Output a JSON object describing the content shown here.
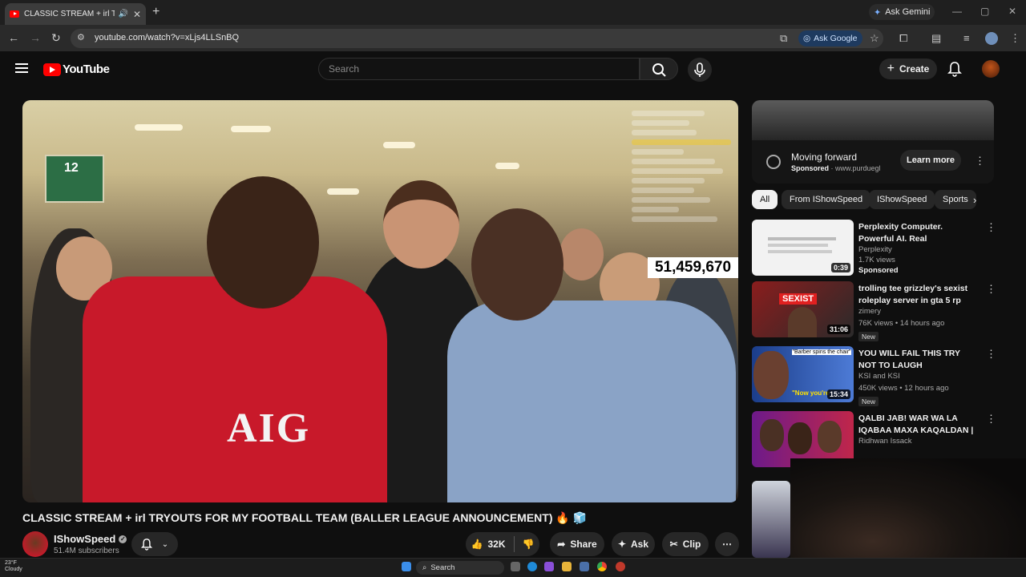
{
  "browser": {
    "tab_title": "CLASSIC STREAM + irl TRYOUTS",
    "new_tab": "+",
    "ask_gemini": "Ask Gemini",
    "url": "youtube.com/watch?v=xLjs4LLSnBQ",
    "ask_google": "Ask Google"
  },
  "header": {
    "logo_text": "YouTube",
    "search_placeholder": "Search",
    "create_label": "Create"
  },
  "video": {
    "shirt_text": "AIG",
    "sign_number": "12",
    "view_counter": "51,459,670",
    "title": "CLASSIC STREAM + irl TRYOUTS FOR MY FOOTBALL TEAM (BALLER LEAGUE ANNOUNCEMENT) 🔥 🧊",
    "channel": "IShowSpeed",
    "subscribers": "51.4M subscribers",
    "likes": "32K",
    "share": "Share",
    "ask": "Ask",
    "clip": "Clip"
  },
  "ad": {
    "title": "Moving forward",
    "sponsored": "Sponsored",
    "domain": "www.purduegl",
    "cta": "Learn more"
  },
  "chips": [
    "All",
    "From IShowSpeed",
    "IShowSpeed",
    "Sports"
  ],
  "recommendations": [
    {
      "title": "Perplexity Computer. Powerful AI. Real Deliverables. Try...",
      "channel": "Perplexity",
      "meta": "1.7K views",
      "badge": "",
      "sponsored": "Sponsored",
      "duration": "0:39"
    },
    {
      "title": "trolling tee grizzley's sexist roleplay server in gta 5 rp",
      "channel": "zimery",
      "meta": "76K views • 14 hours ago",
      "badge": "New",
      "sponsored": "",
      "duration": "31:06",
      "thumb_text": "SEXIST"
    },
    {
      "title": "YOU WILL FAIL THIS TRY NOT TO LAUGH",
      "channel": "KSI and KSI",
      "meta": "450K views • 12 hours ago",
      "badge": "New",
      "sponsored": "",
      "duration": "15:34",
      "thumb_text": "\"Barber spins the chair\"",
      "thumb_text2": "\"Now you're"
    },
    {
      "title": "QALBI JAB! WAR WA LA IQABAA MAXA KAQALDAN | ...",
      "channel": "Ridhwan Issack",
      "meta": "",
      "badge": "",
      "sponsored": "",
      "duration": ""
    }
  ],
  "taskbar": {
    "temp": "23°F",
    "condition": "Cloudy",
    "search": "Search"
  },
  "colors": {
    "brand": "#ff0000",
    "background": "#0f0f0f",
    "surface": "#272727"
  }
}
